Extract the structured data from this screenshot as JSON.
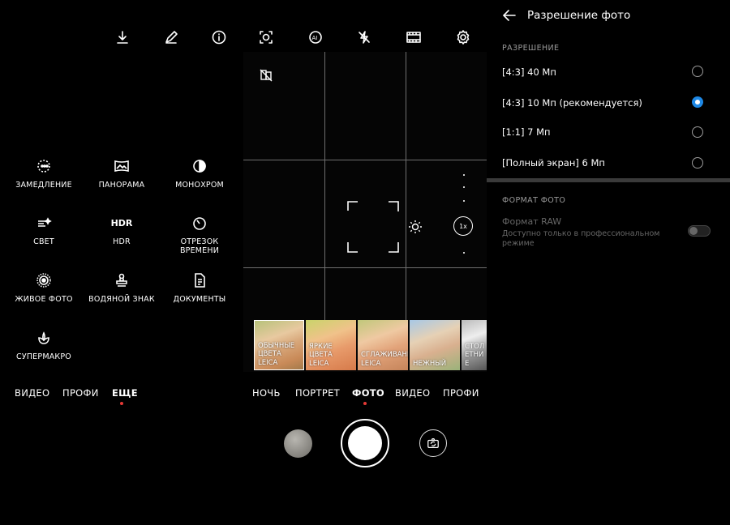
{
  "toolbar": {
    "icons": [
      "download-icon",
      "pencil-icon",
      "info-icon",
      "face-capture-icon",
      "ai-icon",
      "flash-off-icon",
      "film-icon",
      "gear-icon"
    ]
  },
  "modes": [
    {
      "label": "ЗАМЕДЛЕНИЕ",
      "icon": "slow-motion-icon"
    },
    {
      "label": "ПАНОРАМА",
      "icon": "panorama-icon"
    },
    {
      "label": "МОНОХРОМ",
      "icon": "monochrome-icon"
    },
    {
      "label": "СВЕТ",
      "icon": "light-painting-icon"
    },
    {
      "label": "HDR",
      "icon_text": "HDR"
    },
    {
      "label": "ОТРЕЗОК ВРЕМЕНИ",
      "icon": "timelapse-icon"
    },
    {
      "label": "ЖИВОЕ ФОТО",
      "icon": "live-photo-icon"
    },
    {
      "label": "ВОДЯНОЙ ЗНАК",
      "icon": "watermark-icon"
    },
    {
      "label": "ДОКУМЕНТЫ",
      "icon": "document-icon"
    },
    {
      "label": "СУПЕРМАКРО",
      "icon": "super-macro-icon"
    }
  ],
  "left_mode_bar": [
    "ВИДЕО",
    "ПРОФИ",
    "ЕЩЕ"
  ],
  "left_mode_bar_active": "ЕЩЕ",
  "center_mode_bar": [
    "НОЧЬ",
    "ПОРТРЕТ",
    "ФОТО",
    "ВИДЕО",
    "ПРОФИ"
  ],
  "center_mode_bar_active": "ФОТО",
  "filters": [
    {
      "label": "ОБЫЧНЫЕ ЦВЕТА LEICA",
      "selected": true
    },
    {
      "label": "ЯРКИЕ ЦВЕТА LEICA",
      "selected": false
    },
    {
      "label": "СГЛАЖИВАНИЕ LEICA",
      "selected": false
    },
    {
      "label": "НЕЖНЫЙ",
      "selected": false
    },
    {
      "label": "СТОЛЕТНИЕ",
      "selected": false
    }
  ],
  "zoom": {
    "label": "1x"
  },
  "panel": {
    "title": "Разрешение фото",
    "resolution_section": "РАЗРЕШЕНИЕ",
    "options": [
      {
        "label": "[4:3] 40 Мп",
        "selected": false
      },
      {
        "label": "[4:3] 10 Мп (рекомендуется)",
        "selected": true
      },
      {
        "label": "[1:1] 7 Мп",
        "selected": false
      },
      {
        "label": "[Полный экран] 6 Мп",
        "selected": false
      }
    ],
    "format_section": "ФОРМАТ ФОТО",
    "raw_title": "Формат RAW",
    "raw_subtitle": "Доступно только в профессиональном режиме",
    "raw_enabled": false
  },
  "colors": {
    "accent": "#1e88e5",
    "active_dot": "#e53935"
  }
}
